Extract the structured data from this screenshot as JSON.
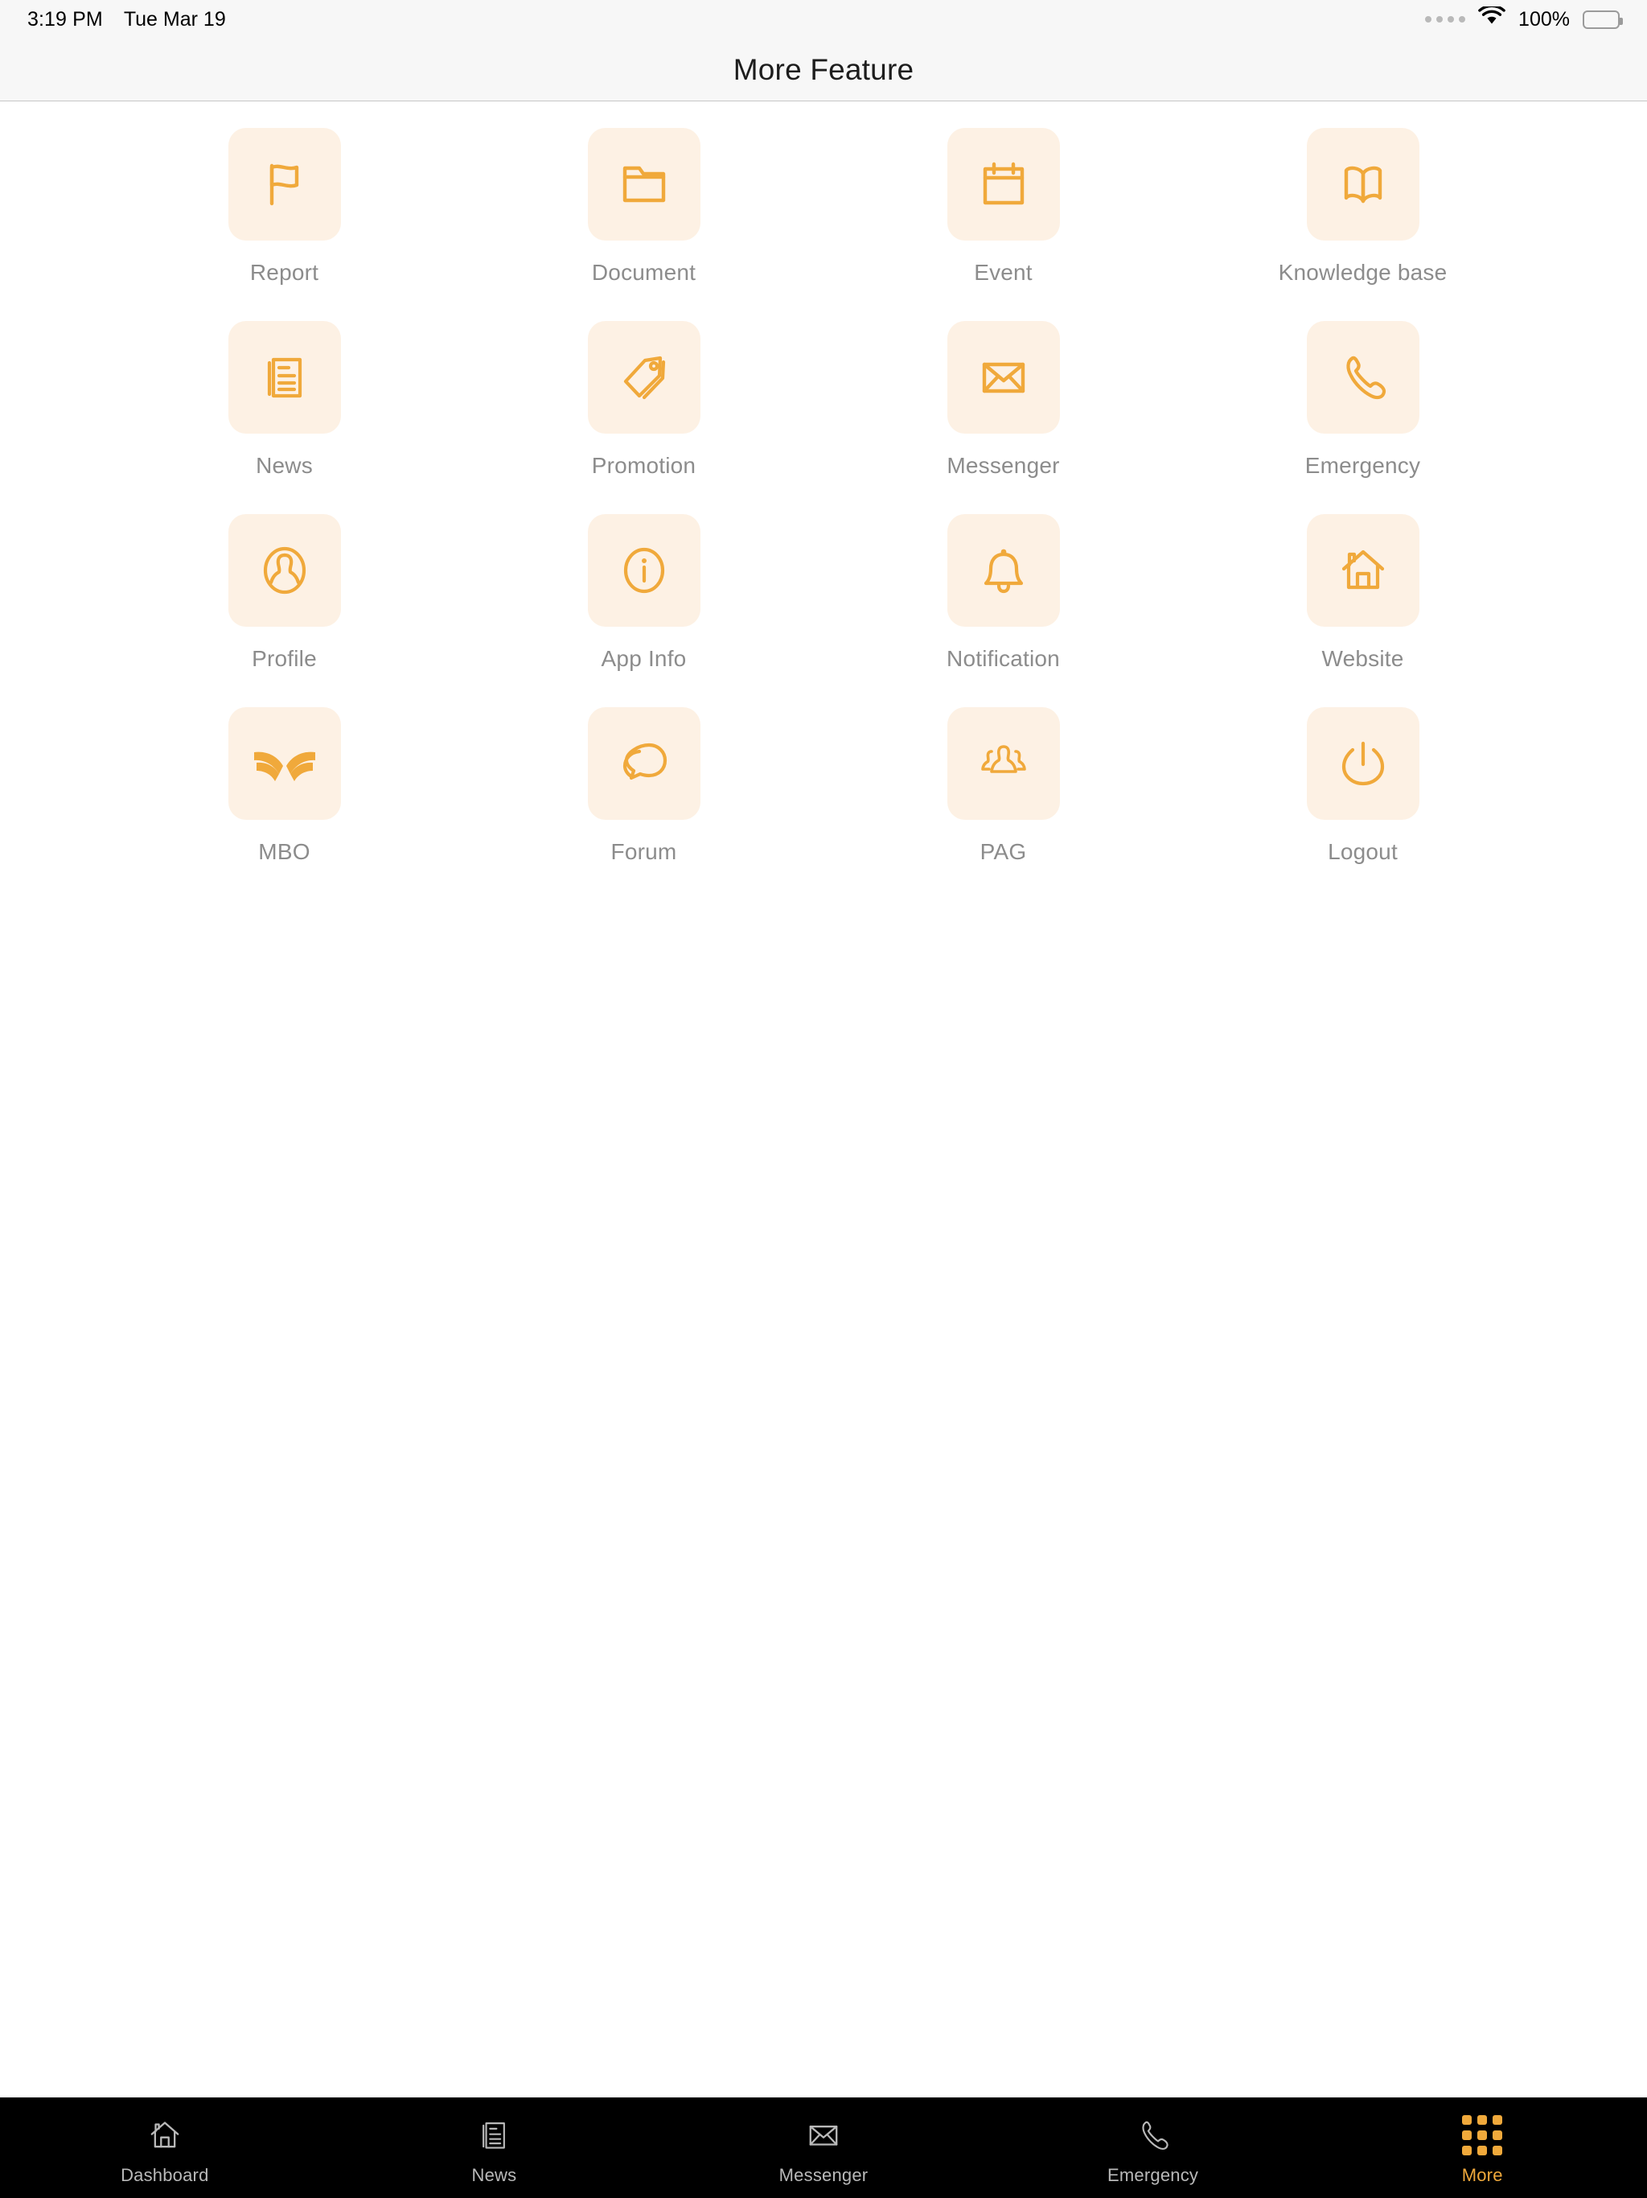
{
  "status_bar": {
    "time": "3:19 PM",
    "date": "Tue Mar 19",
    "battery_percent": "100%",
    "wifi_icon": "wifi-icon",
    "battery_icon": "battery-full-icon",
    "activity_dots_icon": "activity-dots-icon"
  },
  "header": {
    "title": "More Feature"
  },
  "theme": {
    "accent": "#f0a93b",
    "tile_background": "#fdf1e4",
    "label_color": "#8c8c8c",
    "navbar_background": "#f7f7f7",
    "tabbar_background": "#000000",
    "tabbar_inactive": "#b9b9b9",
    "page_background": "#ffffff"
  },
  "grid": {
    "items": [
      {
        "label": "Report",
        "icon": "flag-icon"
      },
      {
        "label": "Document",
        "icon": "folder-icon"
      },
      {
        "label": "Event",
        "icon": "calendar-icon"
      },
      {
        "label": "Knowledge base",
        "icon": "open-book-icon"
      },
      {
        "label": "News",
        "icon": "newspaper-icon"
      },
      {
        "label": "Promotion",
        "icon": "price-tag-icon"
      },
      {
        "label": "Messenger",
        "icon": "envelope-icon"
      },
      {
        "label": "Emergency",
        "icon": "phone-icon"
      },
      {
        "label": "Profile",
        "icon": "person-oval-icon"
      },
      {
        "label": "App Info",
        "icon": "info-icon"
      },
      {
        "label": "Notification",
        "icon": "bell-icon"
      },
      {
        "label": "Website",
        "icon": "house-icon"
      },
      {
        "label": "MBO",
        "icon": "mbo-wings-logo-icon"
      },
      {
        "label": "Forum",
        "icon": "speech-bubbles-icon"
      },
      {
        "label": "PAG",
        "icon": "group-people-icon"
      },
      {
        "label": "Logout",
        "icon": "power-icon"
      }
    ]
  },
  "tabbar": {
    "tabs": [
      {
        "label": "Dashboard",
        "icon": "house-icon",
        "active": false
      },
      {
        "label": "News",
        "icon": "newspaper-icon",
        "active": false
      },
      {
        "label": "Messenger",
        "icon": "envelope-icon",
        "active": false
      },
      {
        "label": "Emergency",
        "icon": "phone-icon",
        "active": false
      },
      {
        "label": "More",
        "icon": "grid-dots-icon",
        "active": true
      }
    ]
  }
}
